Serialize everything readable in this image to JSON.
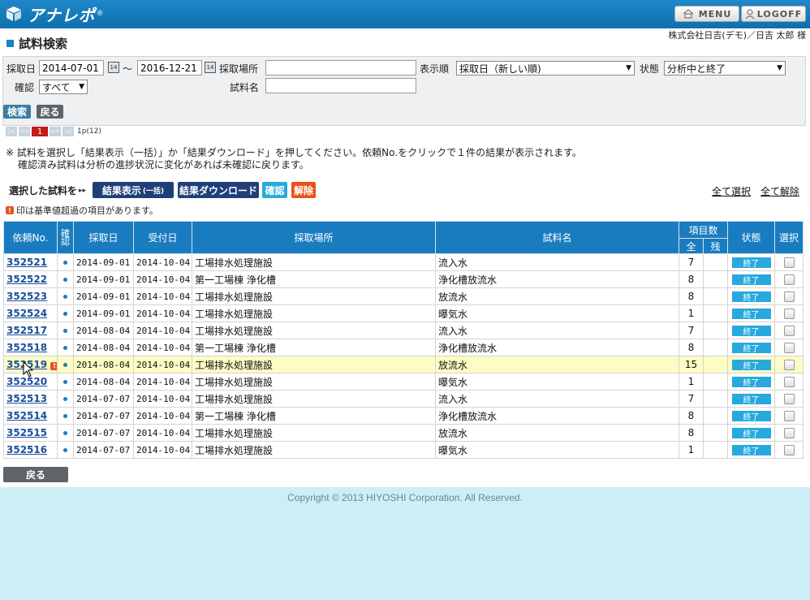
{
  "header": {
    "app_name": "アナレポ",
    "reg_mark": "®",
    "menu_label": "MENU",
    "logoff_label": "LOGOFF"
  },
  "page": {
    "title": "試料検索",
    "user": "株式会社日吉(デモ)／日吉 太郎 様"
  },
  "filter": {
    "sample_date_label": "採取日",
    "date_from": "2014-07-01",
    "range_sep": "～",
    "date_to": "2016-12-21",
    "calendar_icon_text": "14",
    "place_label": "採取場所",
    "place_value": "",
    "order_label": "表示順",
    "order_value": "採取日（新しい順)",
    "status_label": "状態",
    "status_value": "分析中と終了",
    "confirm_label": "確認",
    "confirm_value": "すべて",
    "sample_name_label": "試料名",
    "sample_name_value": ""
  },
  "actions": {
    "search": "検索",
    "back": "戻る"
  },
  "pager": {
    "first": "|<",
    "prev": "<<",
    "current": "1",
    "next": ">>",
    "last": ">|",
    "info": "1p(12)"
  },
  "notes": {
    "line1": "※ 試料を選択し「結果表示（一括）」か「結果ダウンロード」を押してください。依頼No.をクリックで１件の結果が表示されます。",
    "line2": "確認済み試料は分析の進捗状況に変化があれば未確認に戻ります。"
  },
  "selection": {
    "label": "選択した試料を",
    "arrows": "▸▸",
    "show_results": "結果表示",
    "show_results_sub": "(一括)",
    "download": "結果ダウンロード",
    "confirm": "確認",
    "release": "解除",
    "select_all": "全て選択",
    "deselect_all": "全て解除"
  },
  "exceed_note": {
    "icon": "!",
    "text": "印は基準値超過の項目があります。"
  },
  "table": {
    "headers": {
      "id": "依頼No.",
      "confirm": "確認",
      "sample_date": "採取日",
      "received_date": "受付日",
      "place": "採取場所",
      "sample_name": "試料名",
      "item_count": "項目数",
      "all": "全",
      "remain": "残",
      "status": "状態",
      "select": "選択"
    },
    "rows": [
      {
        "id": "352521",
        "sample_date": "2014-09-01",
        "received": "2014-10-04",
        "place": "工場排水処理施設",
        "name": "流入水",
        "all": "7",
        "remain": "",
        "status": "終了",
        "exceed": false,
        "highlight": false
      },
      {
        "id": "352522",
        "sample_date": "2014-09-01",
        "received": "2014-10-04",
        "place": "第一工場棟 浄化槽",
        "name": "浄化槽放流水",
        "all": "8",
        "remain": "",
        "status": "終了",
        "exceed": false,
        "highlight": false
      },
      {
        "id": "352523",
        "sample_date": "2014-09-01",
        "received": "2014-10-04",
        "place": "工場排水処理施設",
        "name": "放流水",
        "all": "8",
        "remain": "",
        "status": "終了",
        "exceed": false,
        "highlight": false
      },
      {
        "id": "352524",
        "sample_date": "2014-09-01",
        "received": "2014-10-04",
        "place": "工場排水処理施設",
        "name": "曝気水",
        "all": "1",
        "remain": "",
        "status": "終了",
        "exceed": false,
        "highlight": false
      },
      {
        "id": "352517",
        "sample_date": "2014-08-04",
        "received": "2014-10-04",
        "place": "工場排水処理施設",
        "name": "流入水",
        "all": "7",
        "remain": "",
        "status": "終了",
        "exceed": false,
        "highlight": false
      },
      {
        "id": "352518",
        "sample_date": "2014-08-04",
        "received": "2014-10-04",
        "place": "第一工場棟 浄化槽",
        "name": "浄化槽放流水",
        "all": "8",
        "remain": "",
        "status": "終了",
        "exceed": false,
        "highlight": false
      },
      {
        "id": "352519",
        "sample_date": "2014-08-04",
        "received": "2014-10-04",
        "place": "工場排水処理施設",
        "name": "放流水",
        "all": "15",
        "remain": "",
        "status": "終了",
        "exceed": true,
        "highlight": true
      },
      {
        "id": "352520",
        "sample_date": "2014-08-04",
        "received": "2014-10-04",
        "place": "工場排水処理施設",
        "name": "曝気水",
        "all": "1",
        "remain": "",
        "status": "終了",
        "exceed": false,
        "highlight": false
      },
      {
        "id": "352513",
        "sample_date": "2014-07-07",
        "received": "2014-10-04",
        "place": "工場排水処理施設",
        "name": "流入水",
        "all": "7",
        "remain": "",
        "status": "終了",
        "exceed": false,
        "highlight": false
      },
      {
        "id": "352514",
        "sample_date": "2014-07-07",
        "received": "2014-10-04",
        "place": "第一工場棟 浄化槽",
        "name": "浄化槽放流水",
        "all": "8",
        "remain": "",
        "status": "終了",
        "exceed": false,
        "highlight": false
      },
      {
        "id": "352515",
        "sample_date": "2014-07-07",
        "received": "2014-10-04",
        "place": "工場排水処理施設",
        "name": "放流水",
        "all": "8",
        "remain": "",
        "status": "終了",
        "exceed": false,
        "highlight": false
      },
      {
        "id": "352516",
        "sample_date": "2014-07-07",
        "received": "2014-10-04",
        "place": "工場排水処理施設",
        "name": "曝気水",
        "all": "1",
        "remain": "",
        "status": "終了",
        "exceed": false,
        "highlight": false
      }
    ]
  },
  "footer": {
    "back": "戻る",
    "copyright": "Copyright © 2013 HIYOSHI Corporation. All Reserved."
  },
  "colors": {
    "header_blue": "#1a7cc0",
    "link_blue": "#1a4f9c",
    "status_cyan": "#28a9dd",
    "release_orange": "#e8531d",
    "highlight_row": "#fdfcc4",
    "footer_bg": "#cdeef6"
  }
}
